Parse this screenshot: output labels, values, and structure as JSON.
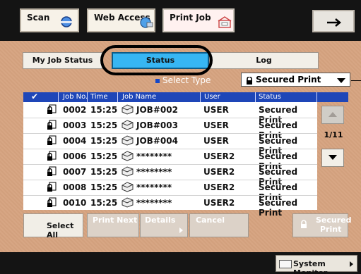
{
  "top_tabs": [
    {
      "label": "Scan",
      "icon": "scan-icon",
      "active": false
    },
    {
      "label": "Web Access",
      "icon": "web-access-icon",
      "active": false
    },
    {
      "label": "Print Job",
      "icon": "print-job-icon",
      "active": true
    }
  ],
  "top_arrow_icon": "arrow-right-icon",
  "sub_tabs": [
    {
      "label": "My Job Status",
      "active": false
    },
    {
      "label": "Status",
      "active": true
    },
    {
      "label": "Log",
      "active": false
    }
  ],
  "select_type": {
    "label": "Select Type",
    "value": "Secured Print"
  },
  "table": {
    "headers": [
      "Job No.",
      "Time",
      "Job Name",
      "User",
      "Status"
    ],
    "rows": [
      {
        "job_no": "0002",
        "time": "15:25",
        "name": "JOB#002",
        "user": "USER",
        "status": "Secured Print"
      },
      {
        "job_no": "0003",
        "time": "15:25",
        "name": "JOB#003",
        "user": "USER",
        "status": "Secured Print"
      },
      {
        "job_no": "0004",
        "time": "15:25",
        "name": "JOB#004",
        "user": "USER",
        "status": "Secured Print"
      },
      {
        "job_no": "0006",
        "time": "15:25",
        "name": "********",
        "user": "USER2",
        "status": "Secured Print"
      },
      {
        "job_no": "0007",
        "time": "15:25",
        "name": "********",
        "user": "USER2",
        "status": "Secured Print"
      },
      {
        "job_no": "0008",
        "time": "15:25",
        "name": "********",
        "user": "USER2",
        "status": "Secured Print"
      },
      {
        "job_no": "0010",
        "time": "15:25",
        "name": "********",
        "user": "USER2",
        "status": "Secured Print"
      }
    ]
  },
  "pagination": {
    "text": "1/11"
  },
  "bottom_buttons": {
    "select_all": "Select All",
    "print_next": "Print Next",
    "details": "Details",
    "cancel": "Cancel",
    "secured_print_line1": "Secured",
    "secured_print_line2": "Print"
  },
  "footer": {
    "system_monitor": "System Monitor"
  },
  "colors": {
    "accent_blue": "#37b6f3",
    "header_blue": "#1e46b8",
    "background": "#d8a98a",
    "topbar": "#141414"
  }
}
